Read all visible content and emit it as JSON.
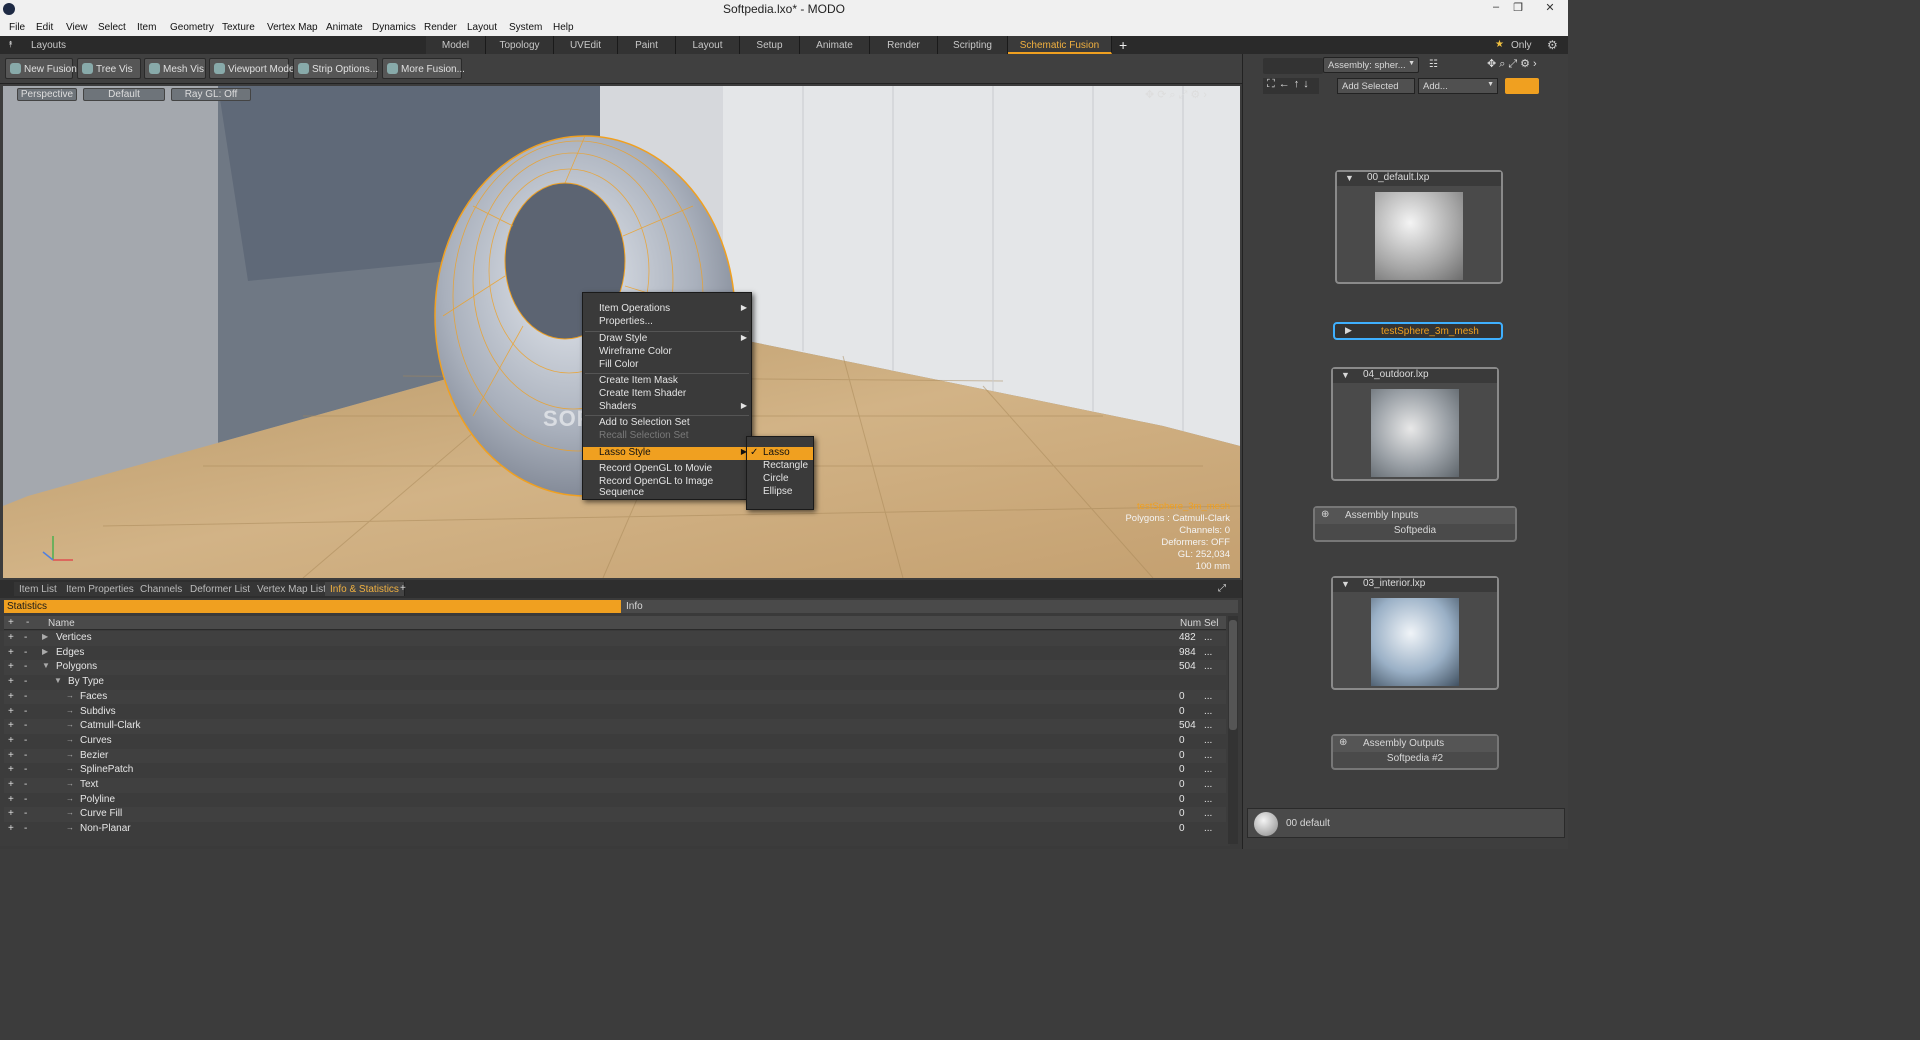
{
  "window": {
    "title": "Softpedia.lxo* - MODO",
    "minimize": "–",
    "restore": "❐",
    "close": "✕"
  },
  "menu": [
    "File",
    "Edit",
    "View",
    "Select",
    "Item",
    "Geometry",
    "Texture",
    "Vertex Map",
    "Animate",
    "Dynamics",
    "Render",
    "Layout",
    "System",
    "Help"
  ],
  "layouts": {
    "label": "Layouts",
    "tabs": [
      "Model",
      "Topology",
      "UVEdit",
      "Paint",
      "Layout",
      "Setup",
      "Animate",
      "Render",
      "Scripting",
      "Schematic Fusion"
    ],
    "active": "Schematic Fusion",
    "add": "+",
    "only": "Only"
  },
  "toolbar": [
    "New Fusion",
    "Tree Vis",
    "Mesh Vis",
    "Viewport Mode",
    "Strip Options...",
    "More Fusion..."
  ],
  "viewport": {
    "buttons": [
      "Perspective",
      "Default",
      "Ray GL: Off"
    ],
    "watermark": "SOFTPEDIA",
    "info": [
      "testSphere_3m_mesh",
      "Polygons : Catmull-Clark",
      "Channels: 0",
      "Deformers: OFF",
      "GL: 252,034",
      "100 mm"
    ]
  },
  "context_menu": {
    "items": [
      "Item Operations",
      "Properties...",
      "Draw Style",
      "Wireframe Color",
      "Fill Color",
      "Create Item Mask",
      "Create Item Shader",
      "Shaders",
      "Add to Selection Set",
      "Recall Selection Set",
      "Lasso Style",
      "Record OpenGL to Movie",
      "Record OpenGL to Image Sequence"
    ],
    "highlighted": "Lasso Style",
    "submenu": [
      "Lasso",
      "Rectangle",
      "Circle",
      "Ellipse"
    ],
    "checked": "✓"
  },
  "schematic": {
    "assembly": "Assembly: spher...",
    "add_selected": "Add Selected",
    "add": "Add...",
    "nodes": [
      "00_default.lxp",
      "testSphere_3m_mesh",
      "04_outdoor.lxp",
      "03_interior.lxp"
    ],
    "inputs_title": "Assembly Inputs",
    "inputs_value": "Softpedia",
    "outputs_title": "Assembly Outputs",
    "outputs_value": "Softpedia #2",
    "preset": "00 default"
  },
  "bottom": {
    "tabs": [
      "Item List",
      "Item Properties",
      "Channels",
      "Deformer List",
      "Vertex Map List",
      "Info & Statistics"
    ],
    "active": "Info & Statistics",
    "add": "+",
    "statistics": "Statistics",
    "info": "Info",
    "col_name": "Name",
    "col_num": "Num",
    "col_sel": "Sel",
    "rows": [
      {
        "name": "Vertices",
        "num": "482",
        "sel": "...",
        "lvl": 0,
        "exp": "▶"
      },
      {
        "name": "Edges",
        "num": "984",
        "sel": "...",
        "lvl": 0,
        "exp": "▶"
      },
      {
        "name": "Polygons",
        "num": "504",
        "sel": "...",
        "lvl": 0,
        "exp": "▼"
      },
      {
        "name": "By Type",
        "num": "",
        "sel": "",
        "lvl": 1,
        "exp": "▼"
      },
      {
        "name": "Faces",
        "num": "0",
        "sel": "...",
        "lvl": 2,
        "exp": "→"
      },
      {
        "name": "Subdivs",
        "num": "0",
        "sel": "...",
        "lvl": 2,
        "exp": "→"
      },
      {
        "name": "Catmull-Clark",
        "num": "504",
        "sel": "...",
        "lvl": 2,
        "exp": "→"
      },
      {
        "name": "Curves",
        "num": "0",
        "sel": "...",
        "lvl": 2,
        "exp": "→"
      },
      {
        "name": "Bezier",
        "num": "0",
        "sel": "...",
        "lvl": 2,
        "exp": "→"
      },
      {
        "name": "SplinePatch",
        "num": "0",
        "sel": "...",
        "lvl": 2,
        "exp": "→"
      },
      {
        "name": "Text",
        "num": "0",
        "sel": "...",
        "lvl": 2,
        "exp": "→"
      },
      {
        "name": "Polyline",
        "num": "0",
        "sel": "...",
        "lvl": 2,
        "exp": "→"
      },
      {
        "name": "Curve Fill",
        "num": "0",
        "sel": "...",
        "lvl": 2,
        "exp": "→"
      },
      {
        "name": "Non-Planar",
        "num": "0",
        "sel": "...",
        "lvl": 2,
        "exp": "→"
      }
    ]
  },
  "colors": {
    "accent": "#f0a020",
    "panel": "#3a3a3a"
  }
}
